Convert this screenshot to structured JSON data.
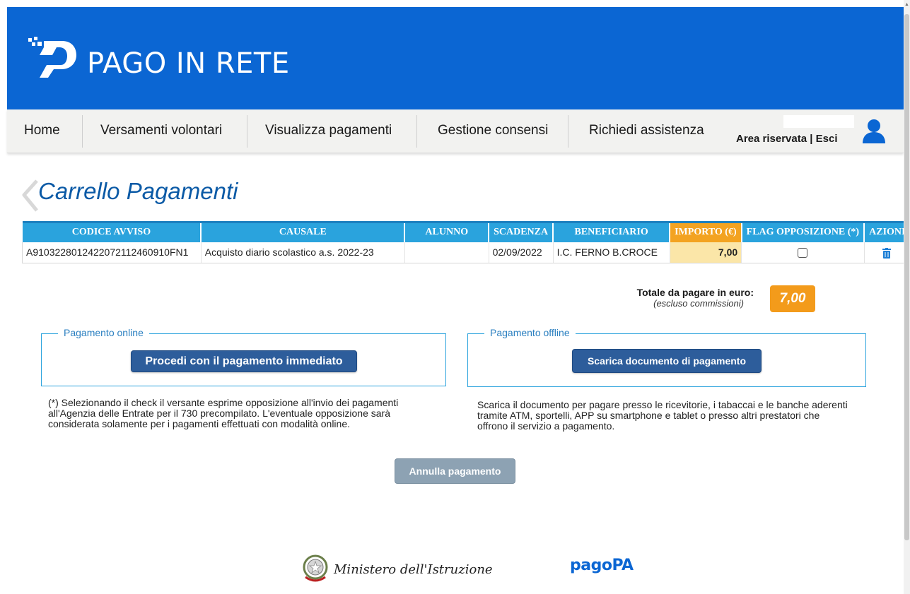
{
  "brand": {
    "title": "PAGO IN RETE"
  },
  "nav": {
    "items": [
      {
        "label": "Home"
      },
      {
        "label": "Versamenti volontari"
      },
      {
        "label": "Visualizza pagamenti"
      },
      {
        "label": "Gestione consensi"
      },
      {
        "label": "Richiedi assistenza"
      }
    ],
    "area_riservata": "Area riservata",
    "separator": "|",
    "esci": "Esci"
  },
  "page": {
    "title": "Carrello Pagamenti"
  },
  "table": {
    "headers": [
      "CODICE AVVISO",
      "CAUSALE",
      "ALUNNO",
      "SCADENZA",
      "BENEFICIARIO",
      "IMPORTO (€)",
      "FLAG OPPOSIZIONE (*)",
      "AZIONI"
    ],
    "rows": [
      {
        "codice": "A9103228012422072112460910FN1",
        "causale": "Acquisto diario scolastico a.s. 2022-23",
        "alunno": "",
        "scadenza": "02/09/2022",
        "beneficiario": "I.C. FERNO B.CROCE",
        "importo": "7,00",
        "flag": false,
        "azione_icon": "trash-icon"
      }
    ]
  },
  "totale": {
    "label": "Totale da pagare in euro:",
    "note": "(escluso commissioni)",
    "value": "7,00"
  },
  "online": {
    "legend": "Pagamento online",
    "button": "Procedi con il pagamento immediato",
    "note": "(*) Selezionando il check il versante esprime opposizione all'invio dei pagamenti all'Agenzia delle Entrate per il 730 precompilato. L'eventuale opposizione sarà considerata solamente per i pagamenti effettuati con modalità online."
  },
  "offline": {
    "legend": "Pagamento offline",
    "button": "Scarica documento di pagamento",
    "note": "Scarica il documento per pagare presso le ricevitorie, i tabaccai e le banche aderenti tramite ATM, sportelli, APP su smartphone e tablet o presso altri prestatori che offrono il servizio a pagamento."
  },
  "cancel_button": "Annulla pagamento",
  "footer": {
    "ministero": "Ministero dell'Istruzione",
    "pagopa": "pagoPA"
  },
  "colors": {
    "header_blue": "#0b66d3",
    "table_header": "#2aa3dd",
    "importo_header": "#f3a321",
    "total_badge": "#f39b1b",
    "primary_button": "#2d5d9b"
  }
}
